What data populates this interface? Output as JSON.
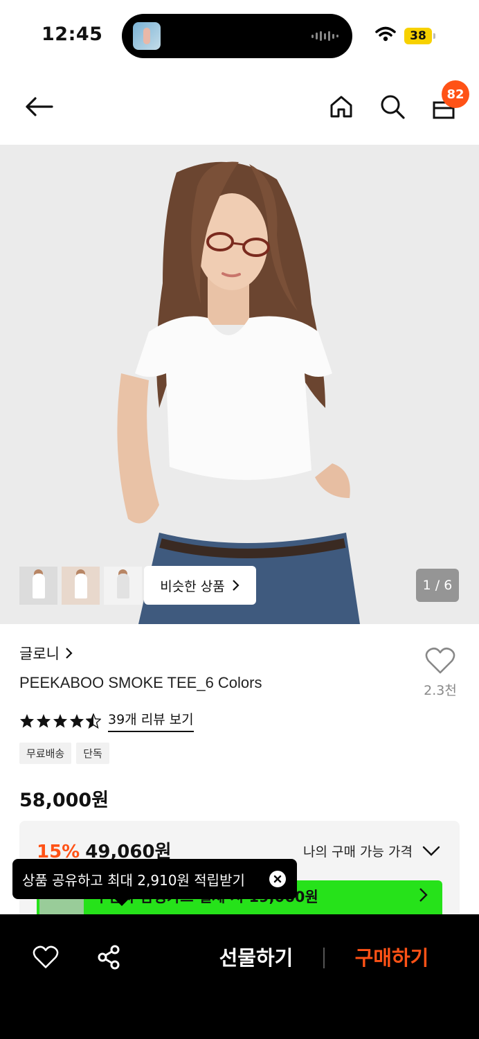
{
  "status_bar": {
    "time": "12:45",
    "battery": "38"
  },
  "header": {
    "cart_count": "82"
  },
  "hero": {
    "similar_label": "비슷한 상품",
    "page_counter": "1 / 6"
  },
  "product": {
    "brand": "글로니",
    "title": "PEEKABOO SMOKE TEE_6 Colors",
    "like_count": "2.3천",
    "rating_stars": 4.5,
    "review_link": "39개 리뷰 보기",
    "tags": [
      "무료배송",
      "단독"
    ],
    "price": "58,000원"
  },
  "price_box": {
    "discount_pct": "15%",
    "discount_price": "49,060원",
    "my_price_label": "나의 구매 가능 가격",
    "card_banner_text": "무신사 삼성카드 결제 시 19,060원"
  },
  "toast": {
    "text": "상품 공유하고 최대 2,910원 적립받기"
  },
  "bottom_bar": {
    "gift_label": "선물하기",
    "buy_label": "구매하기"
  },
  "colors": {
    "accent": "#ff5216",
    "card_banner": "#26e21a",
    "battery": "#f7d100"
  }
}
